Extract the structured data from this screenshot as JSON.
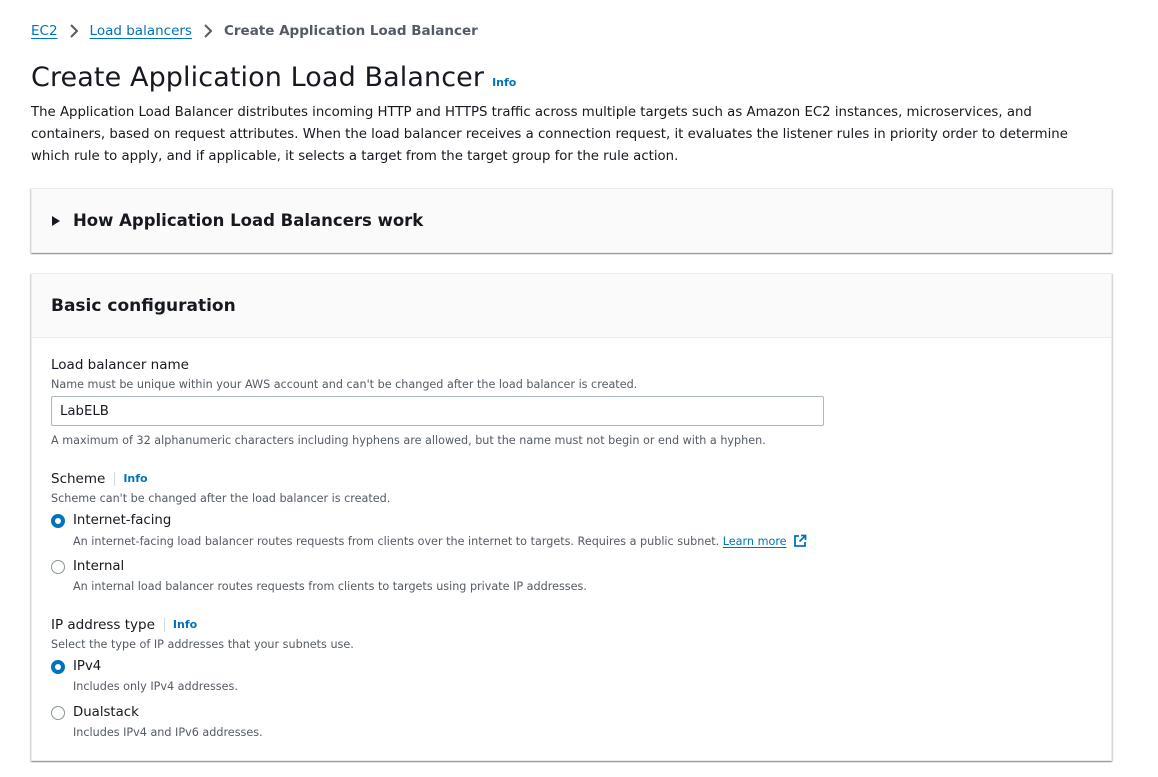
{
  "breadcrumb": {
    "items": [
      {
        "label": "EC2"
      },
      {
        "label": "Load balancers"
      },
      {
        "label": "Create Application Load Balancer"
      }
    ]
  },
  "page": {
    "title": "Create Application Load Balancer",
    "info_label": "Info",
    "description": "The Application Load Balancer distributes incoming HTTP and HTTPS traffic across multiple targets such as Amazon EC2 instances, microservices, and containers, based on request attributes. When the load balancer receives a connection request, it evaluates the listener rules in priority order to determine which rule to apply, and if applicable, it selects a target from the target group for the rule action."
  },
  "how_it_works": {
    "title": "How Application Load Balancers work",
    "expanded": false
  },
  "basic_config": {
    "title": "Basic configuration",
    "name_field": {
      "label": "Load balancer name",
      "description": "Name must be unique within your AWS account and can't be changed after the load balancer is created.",
      "value": "LabELB",
      "constraint": "A maximum of 32 alphanumeric characters including hyphens are allowed, but the name must not begin or end with a hyphen."
    },
    "scheme": {
      "label": "Scheme",
      "info_label": "Info",
      "description": "Scheme can't be changed after the load balancer is created.",
      "options": [
        {
          "label": "Internet-facing",
          "description": "An internet-facing load balancer routes requests from clients over the internet to targets. Requires a public subnet.",
          "link": "Learn more",
          "selected": true
        },
        {
          "label": "Internal",
          "description": "An internal load balancer routes requests from clients to targets using private IP addresses.",
          "selected": false
        }
      ]
    },
    "ip_type": {
      "label": "IP address type",
      "info_label": "Info",
      "description": "Select the type of IP addresses that your subnets use.",
      "options": [
        {
          "label": "IPv4",
          "description": "Includes only IPv4 addresses.",
          "selected": true
        },
        {
          "label": "Dualstack",
          "description": "Includes IPv4 and IPv6 addresses.",
          "selected": false
        }
      ]
    }
  },
  "colors": {
    "link": "#0073bb",
    "text": "#16191f",
    "secondary_text": "#545b64",
    "panel_header_bg": "#fafafa"
  }
}
